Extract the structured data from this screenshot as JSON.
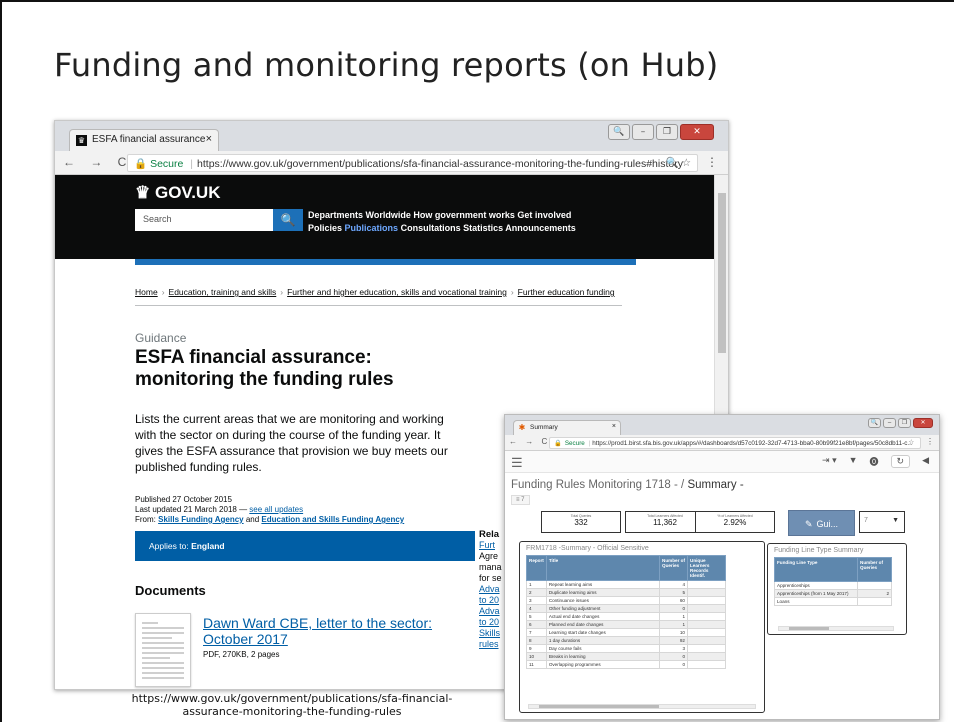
{
  "slide": {
    "title": "Funding and monitoring reports (on Hub)"
  },
  "browser1": {
    "tab_title": "ESFA financial assurance",
    "tab_close": "×",
    "win_controls": [
      "🔍",
      "–",
      "❐",
      "✕"
    ],
    "nav": "← → C",
    "secure_label": "Secure",
    "url": "https://www.gov.uk/government/publications/sfa-financial-assurance-monitoring-the-funding-rules#history",
    "addr_icons": "🔍 ☆",
    "menu": "⋮",
    "gov_logo": "GOV.UK",
    "search_placeholder": "Search",
    "search_button": "🔍",
    "nav_row1": "Departments  Worldwide  How government works  Get involved",
    "nav_row2_a": "Policies",
    "nav_row2_active": "Publications",
    "nav_row2_b": "Consultations  Statistics  Announcements",
    "breadcrumbs": [
      "Home",
      "Education, training and skills",
      "Further and higher education, skills and vocational training",
      "Further education funding"
    ],
    "breadcrumb_sep": "›",
    "guidance": "Guidance",
    "doc_title": "ESFA financial assurance: monitoring the funding rules",
    "lead": "Lists the current areas that we are monitoring and working with the sector on during the course of the funding year. It gives the ESFA assurance that provision we buy meets our published funding rules.",
    "published": "Published 27 October 2015",
    "updated_prefix": "Last updated 21 March 2018 — ",
    "updated_link": "see all updates",
    "from_prefix": "From: ",
    "from_org1": "Skills Funding Agency",
    "from_and": " and ",
    "from_org2": "Education and Skills Funding Agency",
    "applies_prefix": "Applies to: ",
    "applies_value": "England",
    "documents_heading": "Documents",
    "doc_link": "Dawn Ward CBE, letter to the sector: October 2017",
    "doc_meta": "PDF, 270KB, 2 pages",
    "related_heading": "Rela",
    "related_lines": [
      "Furt",
      "Agre",
      "mana",
      "for se",
      "Adva",
      "to 20",
      "Adva",
      "to 20",
      "Skills",
      "rules"
    ]
  },
  "caption": "https://www.gov.uk/government/publications/sfa-financial-assurance-monitoring-the-funding-rules",
  "browser2": {
    "tab_title": "Summary",
    "tab_close": "×",
    "win_controls": [
      "🔍",
      "–",
      "❐",
      "✕"
    ],
    "nav": "← → C",
    "secure_label": "Secure",
    "url": "https://prod1.birst.sfa.bis.gov.uk/apps/#/dashboards/d57c0192-32d7-4713-bba0-80b99f21e8bf/pages/50c8db11-c...",
    "addr_icons": "☆",
    "menu": "⋮",
    "toolbar_icons": [
      "⇥ ▾",
      "▼",
      "⓿",
      "↻",
      "◀"
    ],
    "dashboard_title": "Funding Rules Monitoring 1718 -  /  ",
    "dashboard_page": "Summary -",
    "filter_chip": "≡ 7",
    "kpis": [
      {
        "label": "Total Queries",
        "value": "332"
      },
      {
        "label": "Total Learners Affected",
        "value": "11,362"
      },
      {
        "label": "% of Learners Affected",
        "value": "2.92%"
      }
    ],
    "gui_button": "Gui...",
    "gui_icon": "✎",
    "page_select": "7",
    "page_caret": "▼",
    "panel1": {
      "title": "FRM1718 -Summary - Official Sensitive",
      "columns": [
        "Report",
        "Title",
        "Number of Queries",
        "Unique Learners Records Identif."
      ],
      "rows": [
        {
          "report": "1",
          "title": "Repeat learning aims",
          "queries": "4",
          "unique": ""
        },
        {
          "report": "2",
          "title": "Duplicate learning aims",
          "queries": "5",
          "unique": ""
        },
        {
          "report": "3",
          "title": "Continuance issues",
          "queries": "60",
          "unique": ""
        },
        {
          "report": "4",
          "title": "Other funding adjustment",
          "queries": "0",
          "unique": ""
        },
        {
          "report": "5",
          "title": "Actual end date changes",
          "queries": "1",
          "unique": ""
        },
        {
          "report": "6",
          "title": "Planned end date changes",
          "queries": "1",
          "unique": ""
        },
        {
          "report": "7",
          "title": "Learning start date changes",
          "queries": "10",
          "unique": ""
        },
        {
          "report": "8",
          "title": "1 day durations",
          "queries": "92",
          "unique": ""
        },
        {
          "report": "9",
          "title": "Day course fails",
          "queries": "3",
          "unique": ""
        },
        {
          "report": "10",
          "title": "Breaks in learning",
          "queries": "0",
          "unique": ""
        },
        {
          "report": "11",
          "title": "Overlapping programmes",
          "queries": "0",
          "unique": ""
        }
      ]
    },
    "panel2": {
      "title": "Funding Line Type Summary",
      "columns": [
        "Funding Line Type",
        "Number of Queries"
      ],
      "rows": [
        {
          "type": "Apprenticeships",
          "queries": ""
        },
        {
          "type": "Apprenticeships (from 1 May 2017)",
          "queries": "2"
        },
        {
          "type": "Loans",
          "queries": ""
        }
      ]
    }
  }
}
